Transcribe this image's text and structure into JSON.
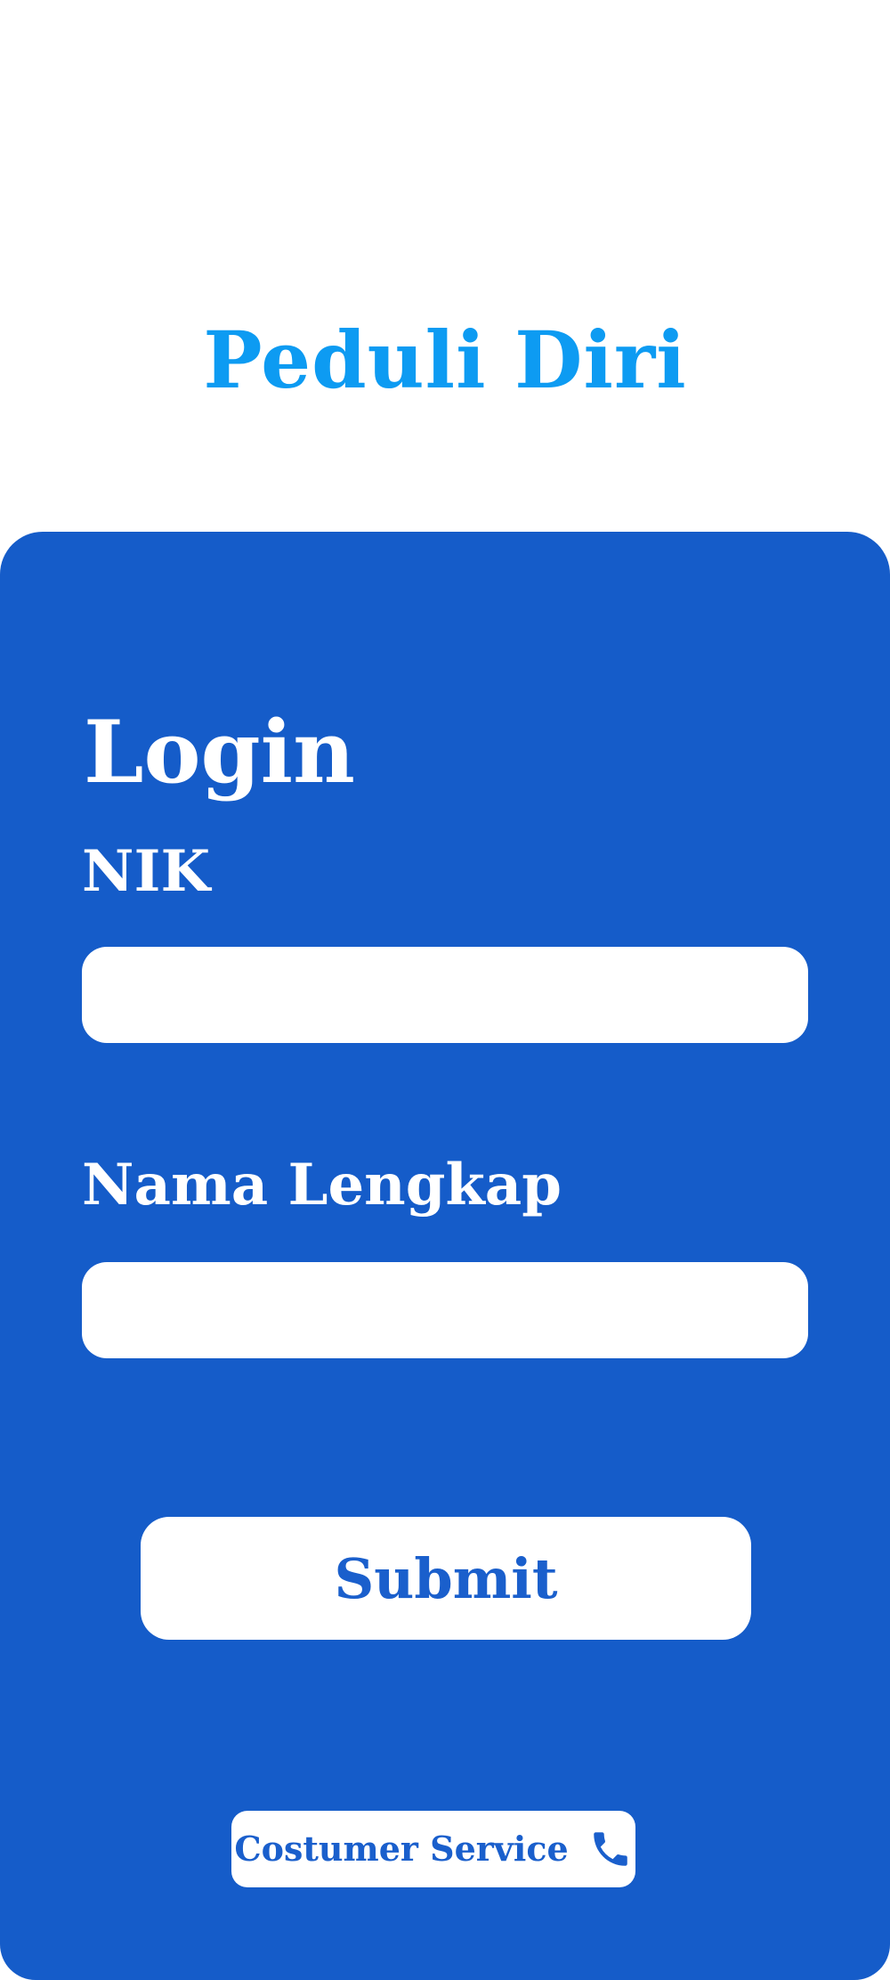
{
  "header": {
    "app_title": "Peduli Diri"
  },
  "login_form": {
    "title": "Login",
    "nik": {
      "label": "NIK",
      "value": "",
      "placeholder": ""
    },
    "nama_lengkap": {
      "label": "Nama Lengkap",
      "value": "",
      "placeholder": ""
    },
    "submit_label": "Submit",
    "customer_service_label": "Costumer Service",
    "customer_service_icon": "phone-icon"
  },
  "colors": {
    "app_title": "#0d9bf2",
    "card_background": "#155cc9",
    "button_text": "#1a5fcc",
    "input_background": "#ffffff"
  }
}
